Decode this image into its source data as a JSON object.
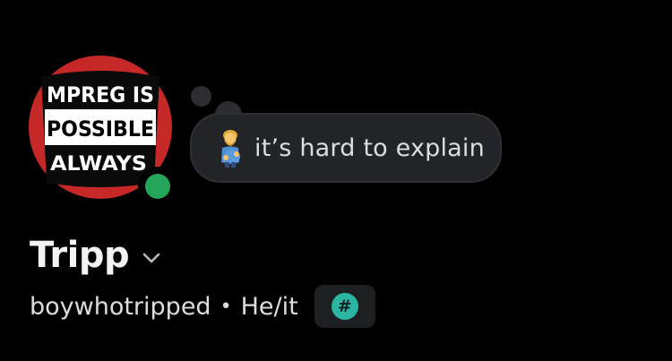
{
  "profile": {
    "avatar": {
      "lines": [
        "MPREG IS",
        "POSSIBLE",
        "ALWAYS"
      ],
      "colors": {
        "ring": "#c62828",
        "plate": "#000000",
        "band": "#ffffff"
      }
    },
    "status": "online",
    "status_color": "#23a55a",
    "custom_status": {
      "emoji": "pregnant-man-emoji",
      "text": "it’s hard to explain"
    },
    "display_name": "Tripp",
    "username": "boywhotripped",
    "separator": "•",
    "pronouns": "He/it",
    "badge": {
      "icon": "hashtag-icon",
      "glyph": "#",
      "color": "#2ab6a2"
    }
  }
}
